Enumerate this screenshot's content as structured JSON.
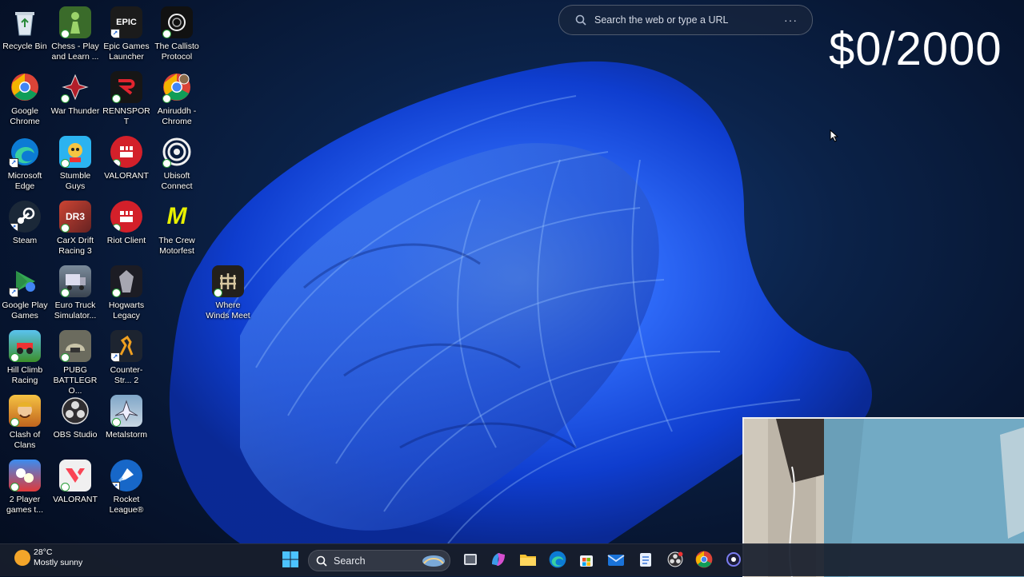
{
  "desktop": {
    "icons": [
      {
        "label": "Recycle Bin"
      },
      {
        "label": "Chess - Play and Learn ..."
      },
      {
        "label": "Epic Games Launcher"
      },
      {
        "label": "The Callisto Protocol"
      },
      {
        "label": "Google Chrome"
      },
      {
        "label": "War Thunder"
      },
      {
        "label": "RENNSPORT"
      },
      {
        "label": "Aniruddh - Chrome"
      },
      {
        "label": "Microsoft Edge"
      },
      {
        "label": "Stumble Guys"
      },
      {
        "label": "VALORANT"
      },
      {
        "label": "Ubisoft Connect"
      },
      {
        "label": "Steam"
      },
      {
        "label": "CarX Drift Racing 3"
      },
      {
        "label": "Riot Client"
      },
      {
        "label": "The Crew Motorfest"
      },
      {
        "label": "Google Play Games"
      },
      {
        "label": "Euro Truck Simulator..."
      },
      {
        "label": "Hogwarts Legacy"
      },
      {
        "label": "Where Winds Meet"
      },
      {
        "label": "Hill Climb Racing"
      },
      {
        "label": "PUBG BATTLEGRO..."
      },
      {
        "label": "Counter-Str... 2"
      },
      {
        "label": "Clash of Clans"
      },
      {
        "label": "OBS Studio"
      },
      {
        "label": "Metalstorm"
      },
      {
        "label": "2 Player games t..."
      },
      {
        "label": "VALORANT"
      },
      {
        "label": "Rocket League®"
      }
    ],
    "icon_glyphs": {
      "epic": "EPIC",
      "carx": "DR3",
      "crew": "M"
    }
  },
  "search_widget": {
    "placeholder": "Search the web or type a URL",
    "more_icon": "···"
  },
  "overlay": {
    "counter": "$0/2000"
  },
  "taskbar": {
    "weather_temp": "28°C",
    "weather_desc": "Mostly sunny",
    "search_label": "Search"
  },
  "colors": {
    "wallpaper_bloom": "#1f5cff",
    "taskbar_bg": "#181e2c"
  }
}
